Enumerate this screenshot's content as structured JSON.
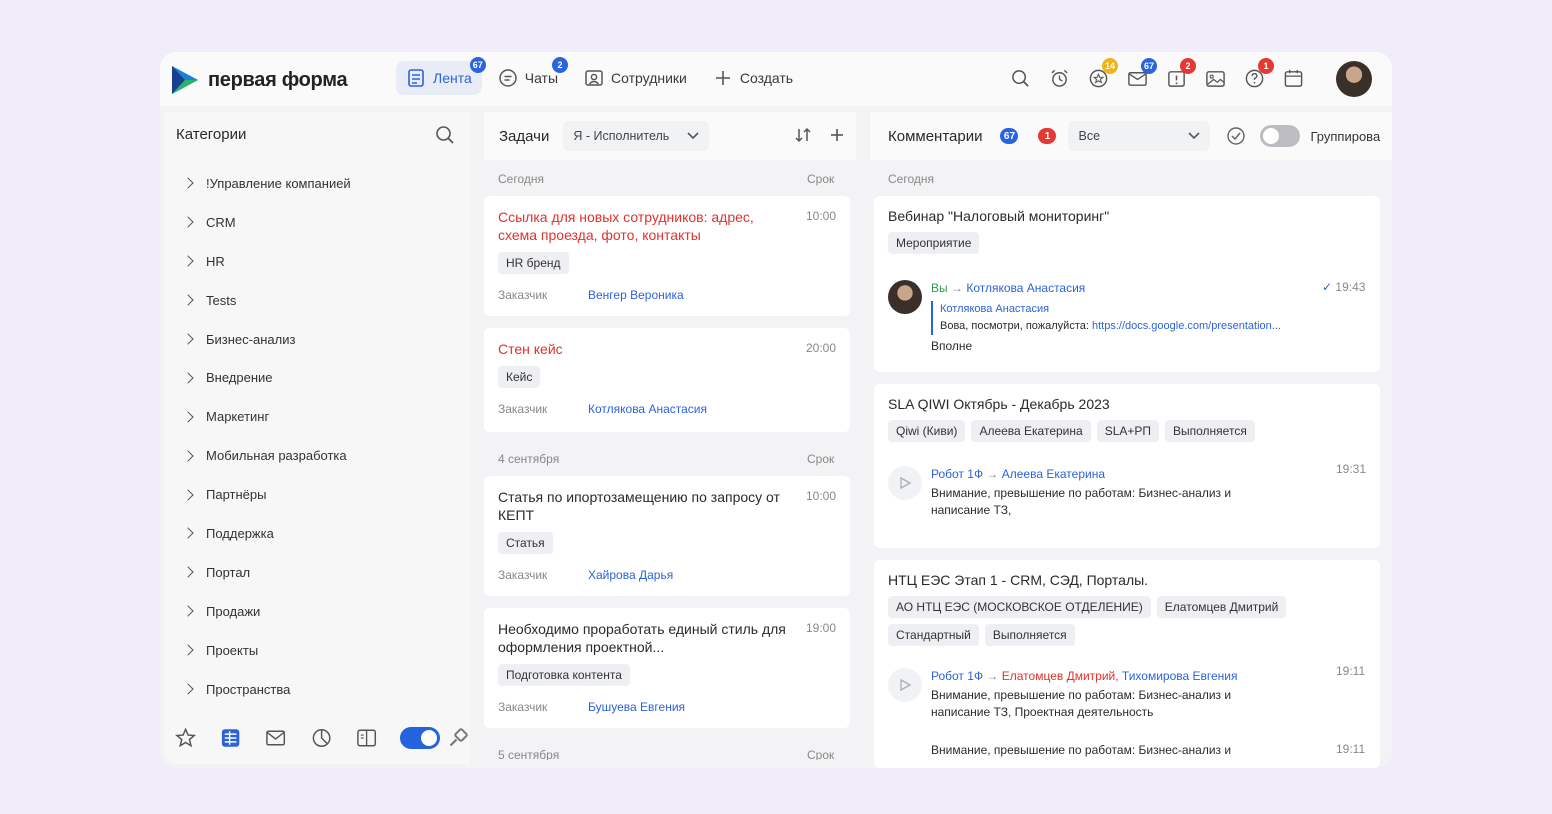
{
  "brand": {
    "name": "первая форма",
    "accent": "#2a64e0"
  },
  "nav": {
    "items": [
      {
        "label": "Лента",
        "badge": "67",
        "icon": "feed-icon"
      },
      {
        "label": "Чаты",
        "badge": "2",
        "icon": "chat-icon"
      },
      {
        "label": "Сотрудники",
        "icon": "employees-icon"
      },
      {
        "label": "Создать",
        "icon": "plus-icon"
      }
    ]
  },
  "topicons": {
    "star_badge": "14",
    "mail_badge": "67",
    "alert_badge": "2",
    "help_badge": "1"
  },
  "categories": {
    "title": "Категории",
    "items": [
      "!Управление компанией",
      "CRM",
      "HR",
      "Tests",
      "Бизнес-анализ",
      "Внедрение",
      "Маркетинг",
      "Мобильная разработка",
      "Партнёры",
      "Поддержка",
      "Портал",
      "Продажи",
      "Проекты",
      "Пространства"
    ]
  },
  "tasks": {
    "title": "Задачи",
    "filter": "Я - Исполнитель",
    "deadline_label": "Срок",
    "customer_label": "Заказчик",
    "sections": [
      {
        "label": "Сегодня"
      },
      {
        "label": "4 сентября"
      },
      {
        "label": "5 сентября"
      }
    ],
    "cards": [
      {
        "title": "Ссылка для новых сотрудников: адрес, схема проезда, фото, контакты",
        "time": "10:00",
        "tag": "HR бренд",
        "customer": "Венгер Вероника"
      },
      {
        "title": "Стен кейс",
        "time": "20:00",
        "tag": "Кейс",
        "customer": "Котлякова Анастасия"
      },
      {
        "title": "Статья по ипортозамещению по запросу от КЕПТ",
        "time": "10:00",
        "tag": "Статья",
        "customer": "Хайрова Дарья"
      },
      {
        "title": "Необходимо проработать единый стиль для оформления проектной...",
        "time": "19:00",
        "tag": "Подготовка контента",
        "customer": "Бушуева Евгения"
      }
    ]
  },
  "comments": {
    "title": "Комментарии",
    "count_blue": "67",
    "count_red": "1",
    "filter": "Все",
    "group_label": "Группирова",
    "section": "Сегодня",
    "cards": [
      {
        "title": "Вебинар \"Налоговый мониторинг\"",
        "tags": [
          "Мероприятие"
        ],
        "from": "Вы",
        "to": "Котлякова Анастасия",
        "time": "19:43",
        "quote_author": "Котлякова Анастасия",
        "quote_text": "Вова, посмотри, пожалуйста:",
        "quote_link": "https://docs.google.com/presentation...",
        "text": "Вполне"
      },
      {
        "title": "SLA QIWI Октябрь - Декабрь 2023",
        "tags": [
          "Qiwi (Киви)",
          "Алеева Екатерина",
          "SLA+РП",
          "Выполняется"
        ],
        "from": "Робот 1Ф",
        "to": "Алеева Екатерина",
        "time": "19:31",
        "text": "Внимание, превышение по работам: Бизнес-анализ и написание ТЗ,"
      },
      {
        "title": "НТЦ ЕЭС Этап 1 - CRM, СЭД, Порталы.",
        "tags": [
          "АО НТЦ ЕЭС (МОСКОВСКОЕ ОТДЕЛЕНИЕ)",
          "Елатомцев Дмитрий",
          "Стандартный",
          "Выполняется"
        ],
        "from": "Робот 1Ф",
        "to_red": "Елатомцев Дмитрий,",
        "to": "Тихомирова Евгения",
        "time": "19:11",
        "text": "Внимание, превышение по работам: Бизнес-анализ и написание ТЗ, Проектная деятельность",
        "text2": "Внимание, превышение по работам: Бизнес-анализ и",
        "time2": "19:11"
      }
    ]
  }
}
